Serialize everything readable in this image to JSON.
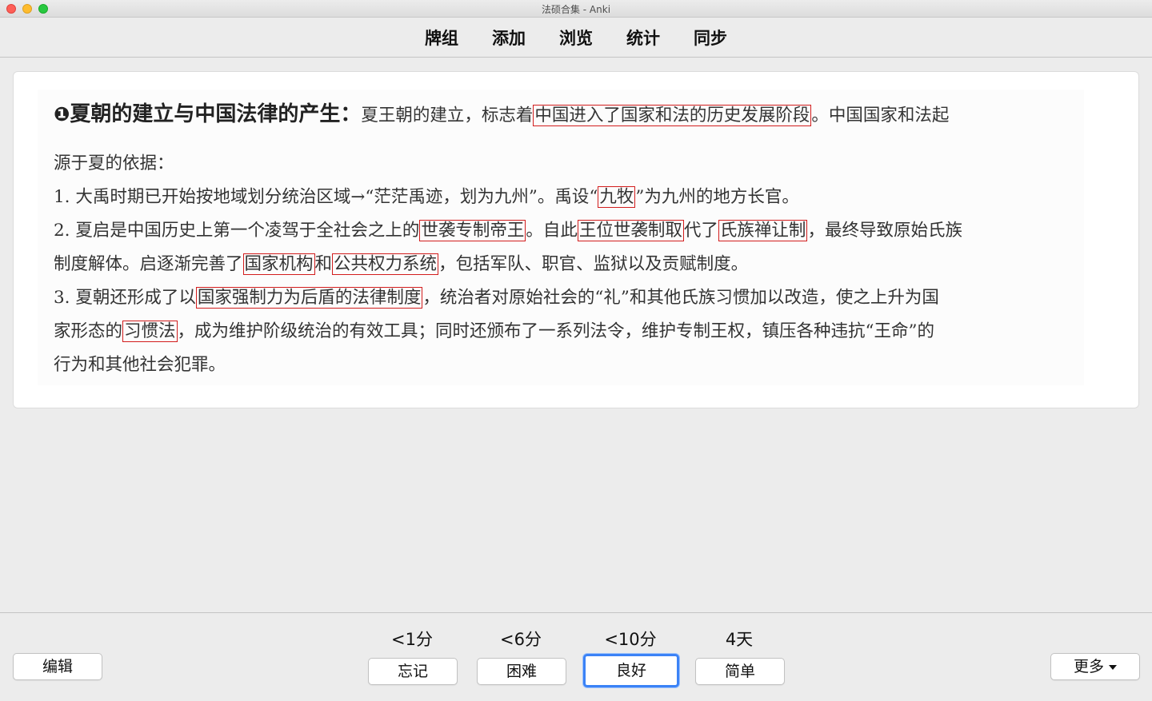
{
  "window": {
    "title": "法硕合集 - Anki"
  },
  "toolbar": {
    "decks": "牌组",
    "add": "添加",
    "browse": "浏览",
    "stats": "统计",
    "sync": "同步"
  },
  "card": {
    "heading_num": "❶",
    "heading_title": "夏朝的建立与中国法律的产生：",
    "l1_a": "夏王朝的建立，标志着",
    "l1_hl1": "中国进入了国家和法的历史发展阶段",
    "l1_b": "。中国国家和法起",
    "l2": "源于夏的依据：",
    "l3_a": "1. 大禹时期已开始按地域划分统治区域→“茫茫禹迹，划为九州”。禹设“",
    "l3_hl1": "九牧",
    "l3_b": "”为九州的地方长官。",
    "l4_a": "2. 夏启是中国历史上第一个凌驾于全社会之上的",
    "l4_hl1": "世袭专制帝王",
    "l4_b": "。自此",
    "l4_hl2": "王位世袭制取",
    "l4_c": "代了",
    "l4_hl3": "氏族禅让制",
    "l4_d": "，最终导致原始氏族",
    "l5_a": "制度解体。启逐渐完善了",
    "l5_hl1": "国家机构",
    "l5_b": "和",
    "l5_hl2": "公共权力系统",
    "l5_c": "，包括军队、职官、监狱以及贡赋制度。",
    "l6_a": "3. 夏朝还形成了以",
    "l6_hl1": "国家强制力为后盾的法律制度",
    "l6_b": "，统治者对原始社会的“礼”和其他氏族习惯加以改造，使之上升为国",
    "l7_a": "家形态的",
    "l7_hl1": "习惯法",
    "l7_b": "，成为维护阶级统治的有效工具；同时还颁布了一系列法令，维护专制王权，镇压各种违抗“王命”的",
    "l8": "行为和其他社会犯罪。",
    "highlight_color": "#d21d1d"
  },
  "bottom": {
    "edit": "编辑",
    "more": "更多",
    "answers": [
      {
        "interval": "<1分",
        "label": "忘记"
      },
      {
        "interval": "<6分",
        "label": "困难"
      },
      {
        "interval": "<10分",
        "label": "良好"
      },
      {
        "interval": "4天",
        "label": "简单"
      }
    ],
    "focused_color": "#3b82f6"
  }
}
